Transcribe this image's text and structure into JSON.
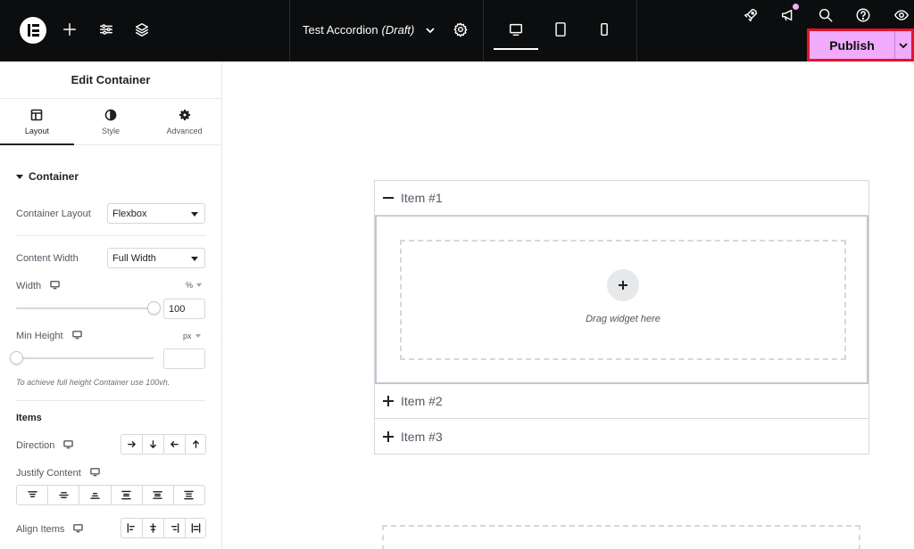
{
  "topbar": {
    "doc_title": "Test Accordion",
    "doc_status": "(Draft)",
    "publish_label": "Publish",
    "colors": {
      "bg": "#0c0d0e",
      "publish_bg": "#f0abfc",
      "highlight": "#e3132f"
    }
  },
  "panel": {
    "title": "Edit Container",
    "tabs": [
      {
        "label": "Layout",
        "icon": "layout-icon"
      },
      {
        "label": "Style",
        "icon": "contrast-icon"
      },
      {
        "label": "Advanced",
        "icon": "gear-icon"
      }
    ],
    "section": "Container",
    "container_layout": {
      "label": "Container Layout",
      "value": "Flexbox"
    },
    "content_width": {
      "label": "Content Width",
      "value": "Full Width"
    },
    "width": {
      "label": "Width",
      "unit": "%",
      "value": "100",
      "fraction": 1.0
    },
    "min_height": {
      "label": "Min Height",
      "unit": "px",
      "value": "",
      "fraction": 0.0
    },
    "hint": "To achieve full height Container use 100vh.",
    "items_heading": "Items",
    "direction_label": "Direction",
    "justify_label": "Justify Content",
    "align_label": "Align Items"
  },
  "canvas": {
    "items": [
      "Item #1",
      "Item #2",
      "Item #3"
    ],
    "drop_text": "Drag widget here"
  }
}
